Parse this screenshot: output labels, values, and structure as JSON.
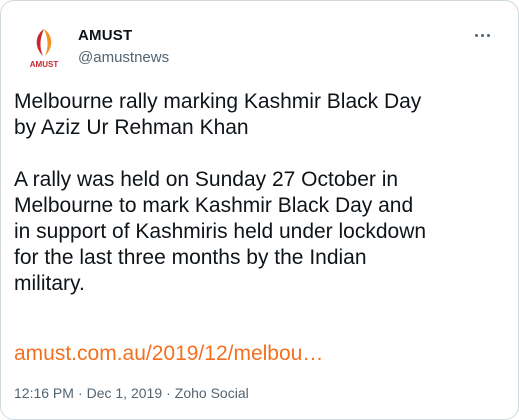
{
  "author": {
    "name": "AMUST",
    "handle": "@amustnews",
    "avatar_text": "AMUST"
  },
  "tweet": {
    "text": "Melbourne rally marking Kashmir Black Day\nby Aziz Ur Rehman Khan\n\nA rally was held on Sunday 27 October in\nMelbourne to mark Kashmir Black Day and\nin support of Kashmiris held under lockdown\nfor the last three months by the Indian\nmilitary.",
    "link_text": "amust.com.au/2019/12/melbou…"
  },
  "meta": {
    "time": "12:16 PM",
    "date": "Dec 1, 2019",
    "source": "Zoho Social",
    "separator": "·"
  },
  "colors": {
    "link": "#f4701f",
    "muted": "#536471",
    "logo_red": "#c9262c",
    "logo_orange": "#f39322"
  },
  "icons": {
    "more": "more-icon"
  }
}
